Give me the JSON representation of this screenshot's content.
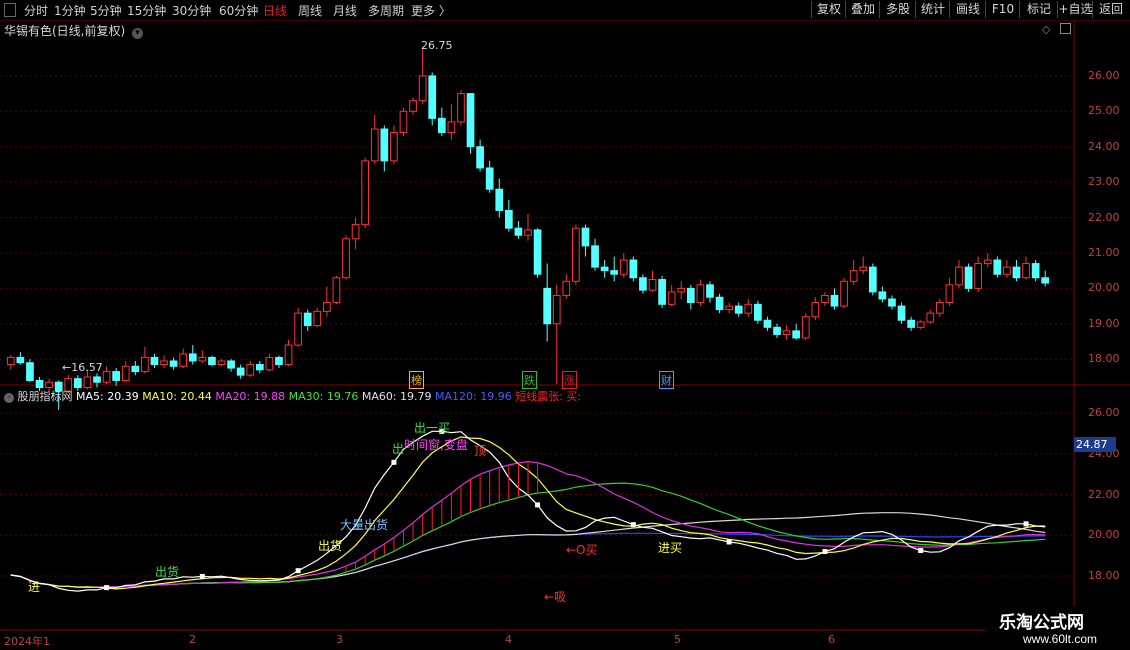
{
  "toolbar": {
    "periods": [
      "分时",
      "1分钟",
      "5分钟",
      "15分钟",
      "30分钟",
      "60分钟",
      "日线",
      "周线",
      "月线",
      "多周期",
      "更多 〉"
    ],
    "active_period": "日线",
    "right_buttons": [
      "复权",
      "叠加",
      "多股",
      "统计",
      "画线",
      "F10",
      "+自选",
      "返回"
    ],
    "mark_button": "标记"
  },
  "title": "华锡有色(日线,前复权)",
  "price_axis": [
    "26.00",
    "25.00",
    "24.00",
    "23.00",
    "22.00",
    "21.00",
    "20.00",
    "19.00",
    "18.00"
  ],
  "indicator_axis": [
    "26.00",
    "24.00",
    "22.00",
    "20.00",
    "18.00"
  ],
  "current_value": "24.87",
  "annotations": {
    "high": "26.75",
    "low": "←16.57"
  },
  "events": [
    {
      "label": "榜",
      "color": "#f0c000"
    },
    {
      "label": "跌",
      "color": "#20c020"
    },
    {
      "label": "涨",
      "color": "#e02020"
    },
    {
      "label": "财",
      "color": "#40a0ff"
    }
  ],
  "indicator": {
    "name": "股朋指标网",
    "legend": [
      {
        "text": "MA5: 20.39",
        "color": "#ffffff"
      },
      {
        "text": "MA10: 20.44",
        "color": "#ffff40"
      },
      {
        "text": "MA20: 19.88",
        "color": "#ff40ff"
      },
      {
        "text": "MA30: 19.76",
        "color": "#40e040"
      },
      {
        "text": "MA60: 19.79",
        "color": "#e0e0e0"
      },
      {
        "text": "MA120: 19.96",
        "color": "#4060ff"
      },
      {
        "text": "短线震张: 买:",
        "color": "#ff2020"
      }
    ]
  },
  "signals": [
    {
      "text": "进",
      "color": "#ffff40"
    },
    {
      "text": "出",
      "color": "#40e040"
    },
    {
      "text": "时间窗,变盘",
      "color": "#ff40ff"
    },
    {
      "text": "大量出货",
      "color": "#80c0ff"
    },
    {
      "text": "出货",
      "color": "#ffff40"
    },
    {
      "text": "顶",
      "color": "#ff4040"
    },
    {
      "text": "←吸",
      "color": "#ff3030"
    },
    {
      "text": "←O买",
      "color": "#ff3030"
    },
    {
      "text": "进买",
      "color": "#ffff40"
    },
    {
      "text": "出货",
      "color": "#40e040"
    },
    {
      "text": "出一买",
      "color": "#40e040"
    }
  ],
  "x_axis": [
    "2024年1",
    "2",
    "3",
    "4",
    "5",
    "6"
  ],
  "watermark": {
    "title": "乐淘公式网",
    "url": "www.60lt.com"
  },
  "chart_data": {
    "type": "candlestick",
    "price_range": [
      17.3,
      26.9
    ],
    "candles": [
      [
        17.85,
        18.05,
        17.7,
        18.12
      ],
      [
        18.05,
        17.9,
        17.85,
        18.2
      ],
      [
        17.9,
        17.4,
        17.35,
        18.0
      ],
      [
        17.4,
        17.2,
        17.1,
        17.5
      ],
      [
        17.2,
        17.35,
        17.05,
        17.45
      ],
      [
        17.35,
        17.1,
        16.57,
        17.4
      ],
      [
        17.1,
        17.45,
        17.05,
        17.55
      ],
      [
        17.45,
        17.2,
        17.1,
        17.55
      ],
      [
        17.2,
        17.5,
        17.15,
        17.7
      ],
      [
        17.5,
        17.35,
        17.2,
        17.6
      ],
      [
        17.35,
        17.65,
        17.3,
        17.8
      ],
      [
        17.65,
        17.4,
        17.25,
        17.75
      ],
      [
        17.4,
        17.8,
        17.35,
        17.95
      ],
      [
        17.8,
        17.65,
        17.55,
        17.95
      ],
      [
        17.65,
        18.05,
        17.6,
        18.35
      ],
      [
        18.05,
        17.85,
        17.75,
        18.15
      ],
      [
        17.85,
        17.95,
        17.75,
        18.1
      ],
      [
        17.95,
        17.8,
        17.7,
        18.05
      ],
      [
        17.8,
        18.15,
        17.75,
        18.3
      ],
      [
        18.15,
        17.95,
        17.85,
        18.4
      ],
      [
        17.95,
        18.05,
        17.9,
        18.25
      ],
      [
        18.05,
        17.85,
        17.8,
        18.1
      ],
      [
        17.85,
        17.95,
        17.8,
        18.0
      ],
      [
        17.95,
        17.75,
        17.65,
        18.0
      ],
      [
        17.75,
        17.55,
        17.45,
        17.85
      ],
      [
        17.55,
        17.85,
        17.5,
        17.95
      ],
      [
        17.85,
        17.7,
        17.6,
        17.95
      ],
      [
        17.7,
        18.05,
        17.65,
        18.15
      ],
      [
        18.05,
        17.85,
        17.75,
        18.1
      ],
      [
        17.85,
        18.4,
        17.8,
        18.55
      ],
      [
        18.4,
        19.3,
        18.35,
        19.45
      ],
      [
        19.3,
        18.95,
        18.8,
        19.4
      ],
      [
        18.95,
        19.35,
        18.9,
        19.45
      ],
      [
        19.35,
        19.6,
        19.2,
        20.05
      ],
      [
        19.6,
        20.3,
        19.55,
        20.35
      ],
      [
        20.3,
        21.4,
        20.25,
        21.5
      ],
      [
        21.4,
        21.8,
        21.1,
        22.0
      ],
      [
        21.8,
        23.6,
        21.7,
        23.7
      ],
      [
        23.6,
        24.5,
        23.5,
        24.9
      ],
      [
        24.5,
        23.6,
        23.3,
        24.6
      ],
      [
        23.6,
        24.4,
        23.5,
        24.6
      ],
      [
        24.4,
        25.0,
        24.3,
        25.1
      ],
      [
        25.0,
        25.3,
        24.9,
        25.4
      ],
      [
        25.3,
        26.0,
        25.2,
        26.75
      ],
      [
        26.0,
        24.8,
        24.6,
        26.1
      ],
      [
        24.8,
        24.4,
        24.3,
        25.1
      ],
      [
        24.4,
        24.7,
        24.2,
        25.2
      ],
      [
        24.7,
        25.5,
        24.6,
        25.6
      ],
      [
        25.5,
        24.0,
        23.8,
        25.5
      ],
      [
        24.0,
        23.4,
        23.3,
        24.2
      ],
      [
        23.4,
        22.8,
        22.7,
        23.6
      ],
      [
        22.8,
        22.2,
        22.0,
        23.1
      ],
      [
        22.2,
        21.7,
        21.6,
        22.5
      ],
      [
        21.7,
        21.5,
        21.4,
        21.9
      ],
      [
        21.5,
        21.65,
        21.35,
        22.1
      ],
      [
        21.65,
        20.4,
        20.3,
        21.7
      ],
      [
        20.0,
        19.0,
        18.5,
        20.7
      ],
      [
        19.0,
        19.8,
        17.3,
        20.1
      ],
      [
        19.8,
        20.2,
        19.7,
        20.4
      ],
      [
        20.2,
        21.7,
        20.1,
        21.8
      ],
      [
        21.7,
        21.2,
        20.9,
        21.8
      ],
      [
        21.2,
        20.6,
        20.5,
        21.4
      ],
      [
        20.6,
        20.5,
        20.3,
        20.8
      ],
      [
        20.5,
        20.4,
        20.2,
        20.9
      ],
      [
        20.4,
        20.8,
        20.3,
        21.0
      ],
      [
        20.8,
        20.3,
        20.2,
        20.9
      ],
      [
        20.3,
        19.95,
        19.85,
        20.4
      ],
      [
        19.95,
        20.25,
        19.9,
        20.5
      ],
      [
        20.25,
        19.55,
        19.45,
        20.35
      ],
      [
        19.55,
        19.9,
        19.5,
        20.1
      ],
      [
        19.9,
        20.0,
        19.7,
        20.2
      ],
      [
        20.0,
        19.6,
        19.4,
        20.1
      ],
      [
        19.6,
        20.1,
        19.5,
        20.25
      ],
      [
        20.1,
        19.75,
        19.6,
        20.2
      ],
      [
        19.75,
        19.4,
        19.3,
        19.85
      ],
      [
        19.4,
        19.5,
        19.3,
        19.6
      ],
      [
        19.5,
        19.3,
        19.2,
        19.6
      ],
      [
        19.3,
        19.55,
        19.2,
        19.7
      ],
      [
        19.55,
        19.1,
        19.0,
        19.65
      ],
      [
        19.1,
        18.9,
        18.8,
        19.2
      ],
      [
        18.9,
        18.7,
        18.6,
        19.0
      ],
      [
        18.7,
        18.8,
        18.55,
        18.95
      ],
      [
        18.8,
        18.6,
        18.55,
        19.0
      ],
      [
        18.6,
        19.2,
        18.55,
        19.3
      ],
      [
        19.2,
        19.6,
        19.1,
        19.75
      ],
      [
        19.6,
        19.8,
        19.5,
        19.9
      ],
      [
        19.8,
        19.5,
        19.4,
        20.0
      ],
      [
        19.5,
        20.2,
        19.45,
        20.3
      ],
      [
        20.2,
        20.5,
        20.1,
        20.8
      ],
      [
        20.5,
        20.6,
        20.4,
        20.9
      ],
      [
        20.6,
        19.9,
        19.8,
        20.7
      ],
      [
        19.9,
        19.7,
        19.6,
        20.05
      ],
      [
        19.7,
        19.5,
        19.4,
        19.8
      ],
      [
        19.5,
        19.1,
        19.0,
        19.6
      ],
      [
        19.1,
        18.9,
        18.8,
        19.2
      ],
      [
        18.9,
        19.05,
        18.85,
        19.1
      ],
      [
        19.05,
        19.3,
        19.0,
        19.4
      ],
      [
        19.3,
        19.6,
        19.2,
        19.7
      ],
      [
        19.6,
        20.1,
        19.5,
        20.3
      ],
      [
        20.1,
        20.6,
        20.0,
        20.8
      ],
      [
        20.6,
        20.0,
        19.9,
        20.7
      ],
      [
        20.0,
        20.7,
        19.9,
        20.9
      ],
      [
        20.7,
        20.8,
        20.6,
        21.0
      ],
      [
        20.8,
        20.4,
        20.3,
        20.9
      ],
      [
        20.4,
        20.6,
        20.3,
        20.8
      ],
      [
        20.6,
        20.3,
        20.2,
        20.8
      ],
      [
        20.3,
        20.7,
        20.25,
        20.9
      ],
      [
        20.7,
        20.3,
        20.2,
        20.8
      ],
      [
        20.3,
        20.15,
        20.05,
        20.5
      ]
    ]
  }
}
